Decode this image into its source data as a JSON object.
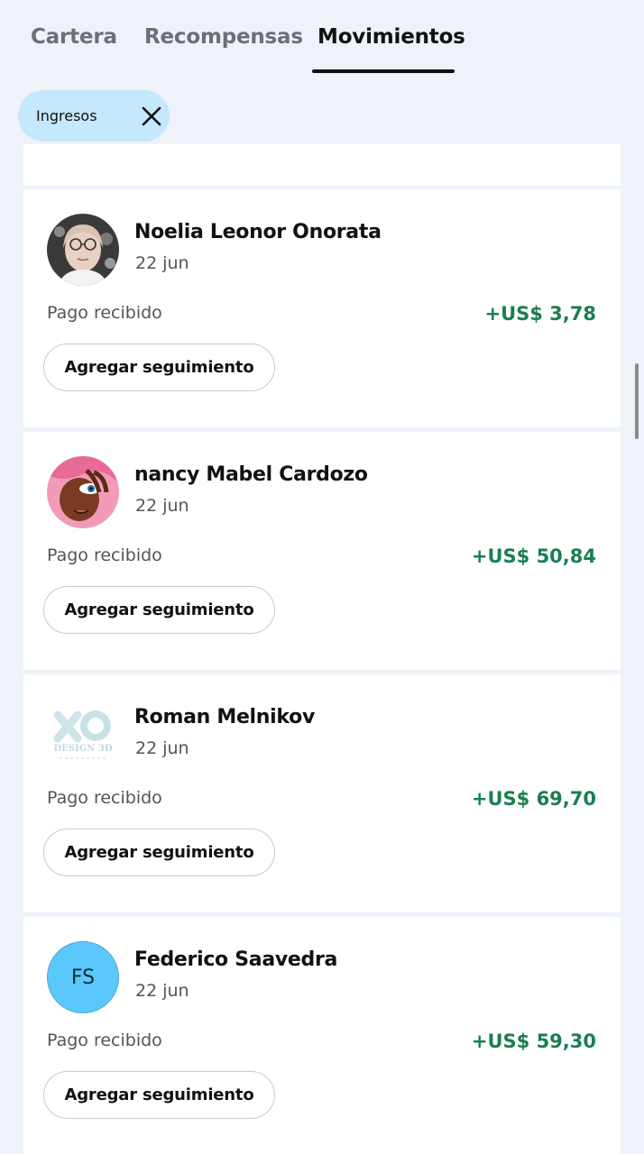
{
  "tabs": [
    {
      "label": "Cartera"
    },
    {
      "label": "Recompensas"
    },
    {
      "label": "Movimientos"
    }
  ],
  "active_tab": "Movimientos",
  "filter_chip": {
    "label": "Ingresos",
    "close_icon": "close-icon"
  },
  "transactions": [
    {
      "name": "Noelia Leonor Onorata",
      "date": "22 jun",
      "status": "Pago recibido",
      "amount": "+US$ 3,78",
      "avatar": "photo",
      "action": "Agregar seguimiento"
    },
    {
      "name": "nancy Mabel Cardozo",
      "date": "22 jun",
      "status": "Pago recibido",
      "amount": "+US$ 50,84",
      "avatar": "illustration",
      "action": "Agregar seguimiento"
    },
    {
      "name": "Roman Melnikov",
      "date": "22 jun",
      "status": "Pago recibido",
      "amount": "+US$ 69,70",
      "avatar": "logo",
      "avatar_text": "DESIGN 3D",
      "action": "Agregar seguimiento"
    },
    {
      "name": "Federico Saavedra",
      "date": "22 jun",
      "status": "Pago recibido",
      "amount": "+US$ 59,30",
      "avatar": "initials",
      "avatar_text": "FS",
      "action": "Agregar seguimiento"
    }
  ],
  "colors": {
    "background": "#eef2f9",
    "chip": "#c5e8fb",
    "amount": "#1a7f52",
    "initials_avatar": "#5bc8fb"
  }
}
